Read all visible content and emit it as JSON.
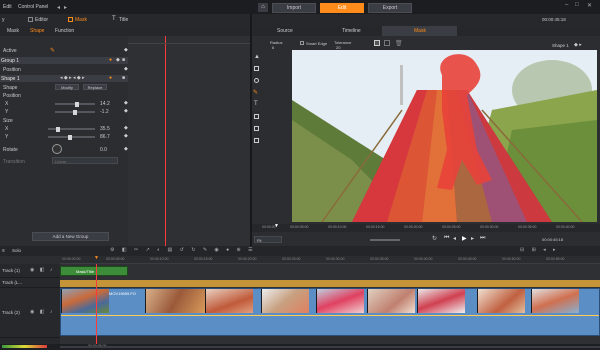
{
  "menu": {
    "items": [
      "Edit",
      "Control Panel"
    ]
  },
  "top_tabs": {
    "editor": "Editor",
    "mask": "Mask",
    "title": "Title"
  },
  "nav_tabs": {
    "import": "Import",
    "edit": "Edit",
    "export": "Export"
  },
  "timecodes": {
    "right_top": "00:00:45:18",
    "right_top2": "00:00:30:18"
  },
  "mask_panel": {
    "tabs": [
      "Mask",
      "Shape",
      "Function"
    ],
    "active_tab": "Shape",
    "active_label": "Active",
    "group_label": "Group 1",
    "position_label": "Position",
    "shape_label": "Shape 1",
    "shape_row_label": "Shape",
    "modify_btn": "Modify",
    "replace_btn": "Replace",
    "position_head": "Position",
    "x_label": "X",
    "x_value": "14.2",
    "y_label": "Y",
    "y_value": "-1.2",
    "size_head": "Size",
    "size_x_label": "X",
    "size_x_value": "35.5",
    "size_y_label": "Y",
    "size_y_value": "86.7",
    "rotate_label": "Rotate",
    "rotate_value": "0.0",
    "transition_label": "Transition",
    "transition_value": "Linear",
    "add_group_btn": "Add a New Group"
  },
  "viewer": {
    "tabs": [
      "Source",
      "Timeline",
      "Mask"
    ],
    "active_tab": "Mask",
    "radius_label": "Radius",
    "radius_value": "6",
    "smart_edge_label": "Smart Edge",
    "tolerance_label": "Tolerance",
    "tolerance_value": "20",
    "shape_select": "Shape 1",
    "ruler": [
      "00:00:00",
      "00:00:05:00",
      "00:00:10:00",
      "00:00:15:00",
      "00:00:20:00",
      "00:00:25:00",
      "00:00:30:00",
      "00:00:35:00",
      "00:00:40:00"
    ],
    "fit_label": "Fit",
    "transport_time": "00:00:45:18"
  },
  "timeline": {
    "solo_label": "Solo",
    "ruler": [
      "00:00:00:00",
      "00:00:05:00",
      "00:00:10:00",
      "00:00:15:00",
      "00:00:20:00",
      "00:00:25:00",
      "00:00:30:00",
      "00:00:35:00",
      "00:00:40:00",
      "00:00:45:00",
      "00:00:50:00",
      "00:00:55:00"
    ],
    "tracks": [
      {
        "name": "Track (1)"
      },
      {
        "name": "Track (L..."
      },
      {
        "name": "Track (2)"
      }
    ],
    "mask_clip_label": "Mask/Title",
    "video_clip_label": "MOV19659.FO",
    "bottom_time": "00:00:05:00"
  },
  "colors": {
    "accent": "#ff8c1a",
    "mask_overlay": "#e0383e",
    "clip_blue": "#5b8ec4",
    "clip_green": "#3d8c3a"
  }
}
